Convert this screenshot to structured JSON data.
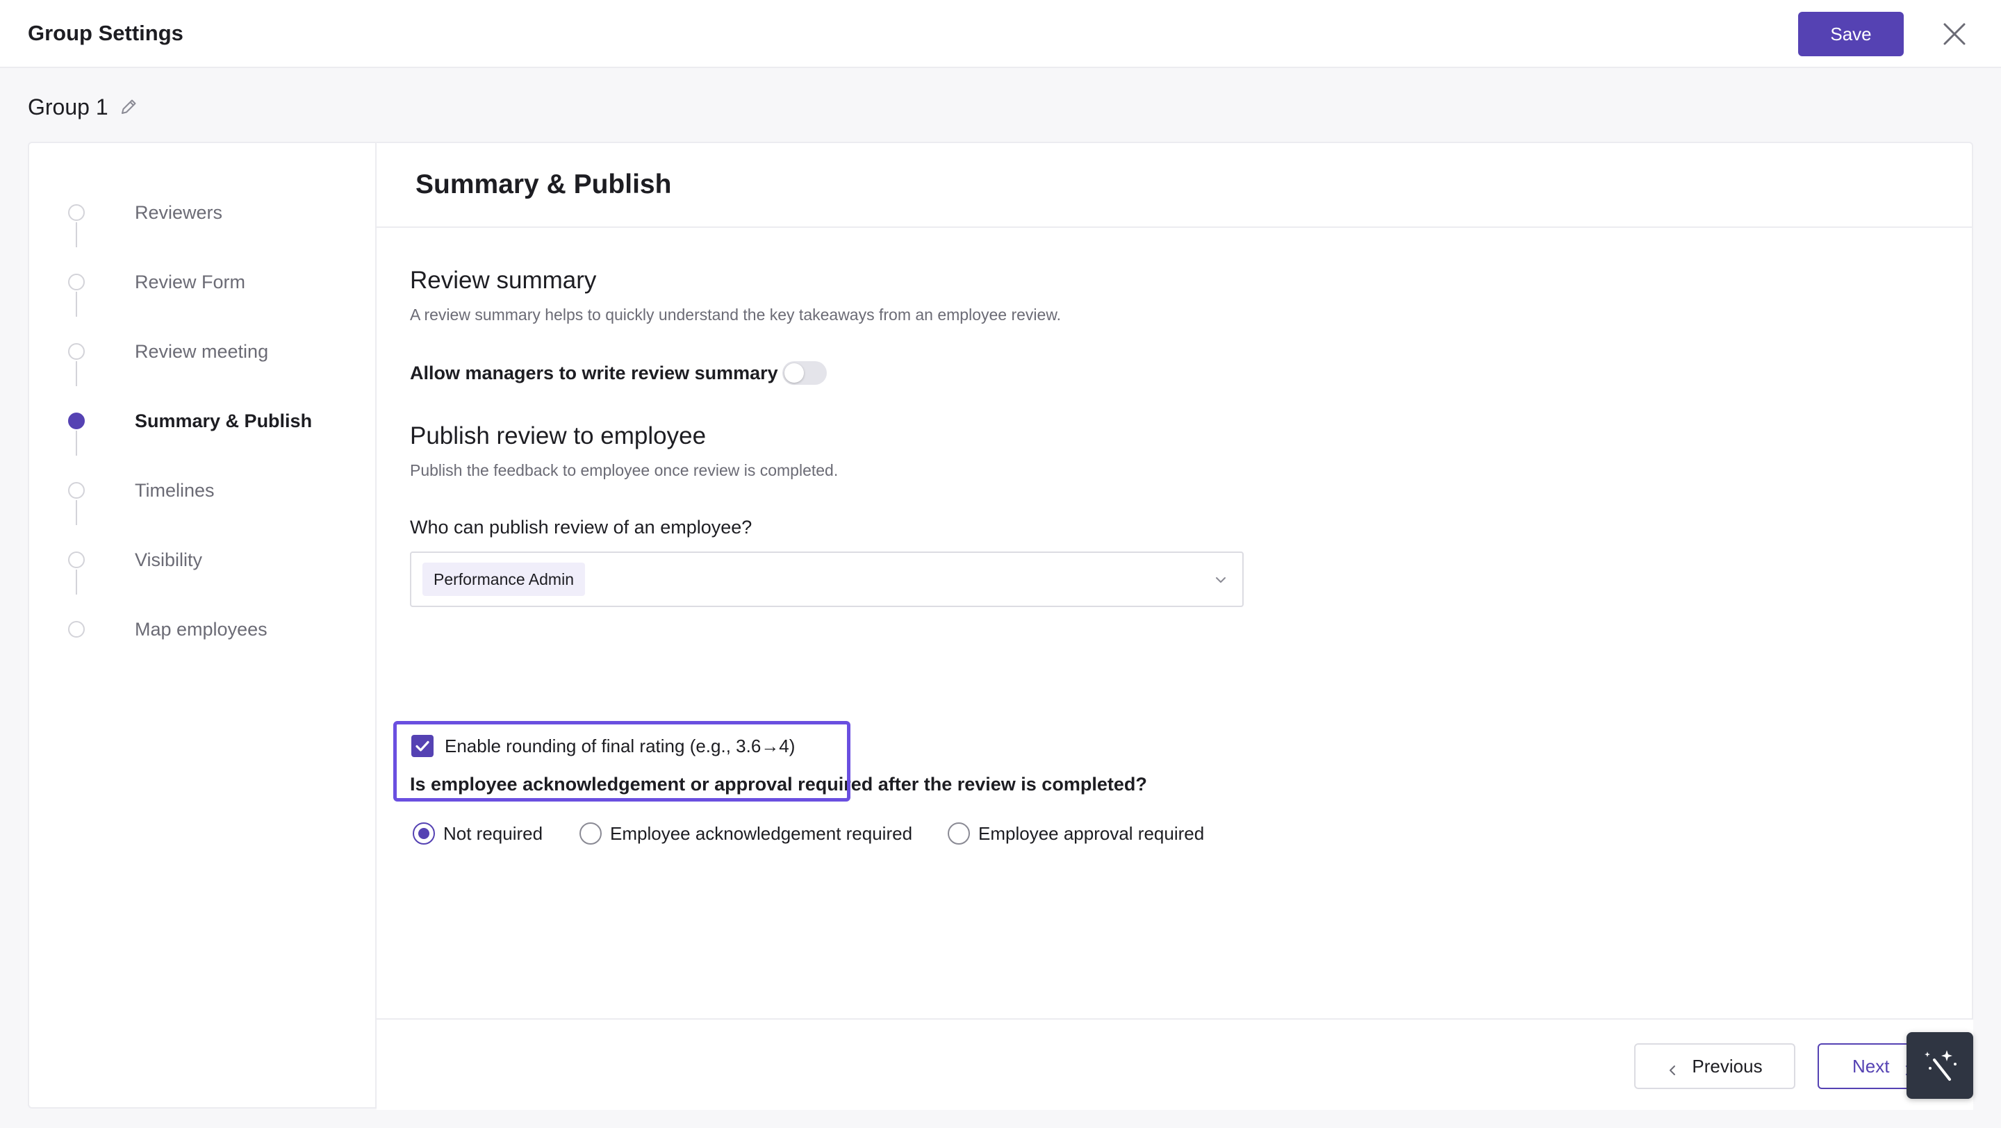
{
  "header": {
    "title": "Group Settings",
    "save_label": "Save",
    "close_icon": "close-icon"
  },
  "group": {
    "name": "Group 1",
    "edit_icon": "pencil-icon"
  },
  "sidebar": {
    "steps": [
      {
        "label": "Reviewers",
        "active": false
      },
      {
        "label": "Review Form",
        "active": false
      },
      {
        "label": "Review meeting",
        "active": false
      },
      {
        "label": "Summary & Publish",
        "active": true
      },
      {
        "label": "Timelines",
        "active": false
      },
      {
        "label": "Visibility",
        "active": false
      },
      {
        "label": "Map employees",
        "active": false
      }
    ]
  },
  "content": {
    "title": "Summary & Publish",
    "review_summary": {
      "heading": "Review summary",
      "description": "A review summary helps to quickly understand the key takeaways from an employee review.",
      "toggle_label": "Allow managers to write review summary",
      "toggle_on": false
    },
    "publish": {
      "heading": "Publish review to employee",
      "description": "Publish the feedback to employee once review is completed.",
      "who_label": "Who can publish review of an employee?",
      "selected_value": "Performance Admin",
      "ack_label": "Is employee acknowledgement or approval required after the review is completed?",
      "options": [
        {
          "label": "Not required",
          "checked": true
        },
        {
          "label": "Employee acknowledgement required",
          "checked": false
        },
        {
          "label": "Employee approval required",
          "checked": false
        }
      ],
      "rounding_label": "Enable rounding of final rating (e.g., 3.6→4)",
      "rounding_checked": true
    }
  },
  "footer": {
    "previous_label": "Previous",
    "next_label": "Next"
  },
  "colors": {
    "accent": "#5542b3",
    "highlight": "#6a4fe0"
  }
}
